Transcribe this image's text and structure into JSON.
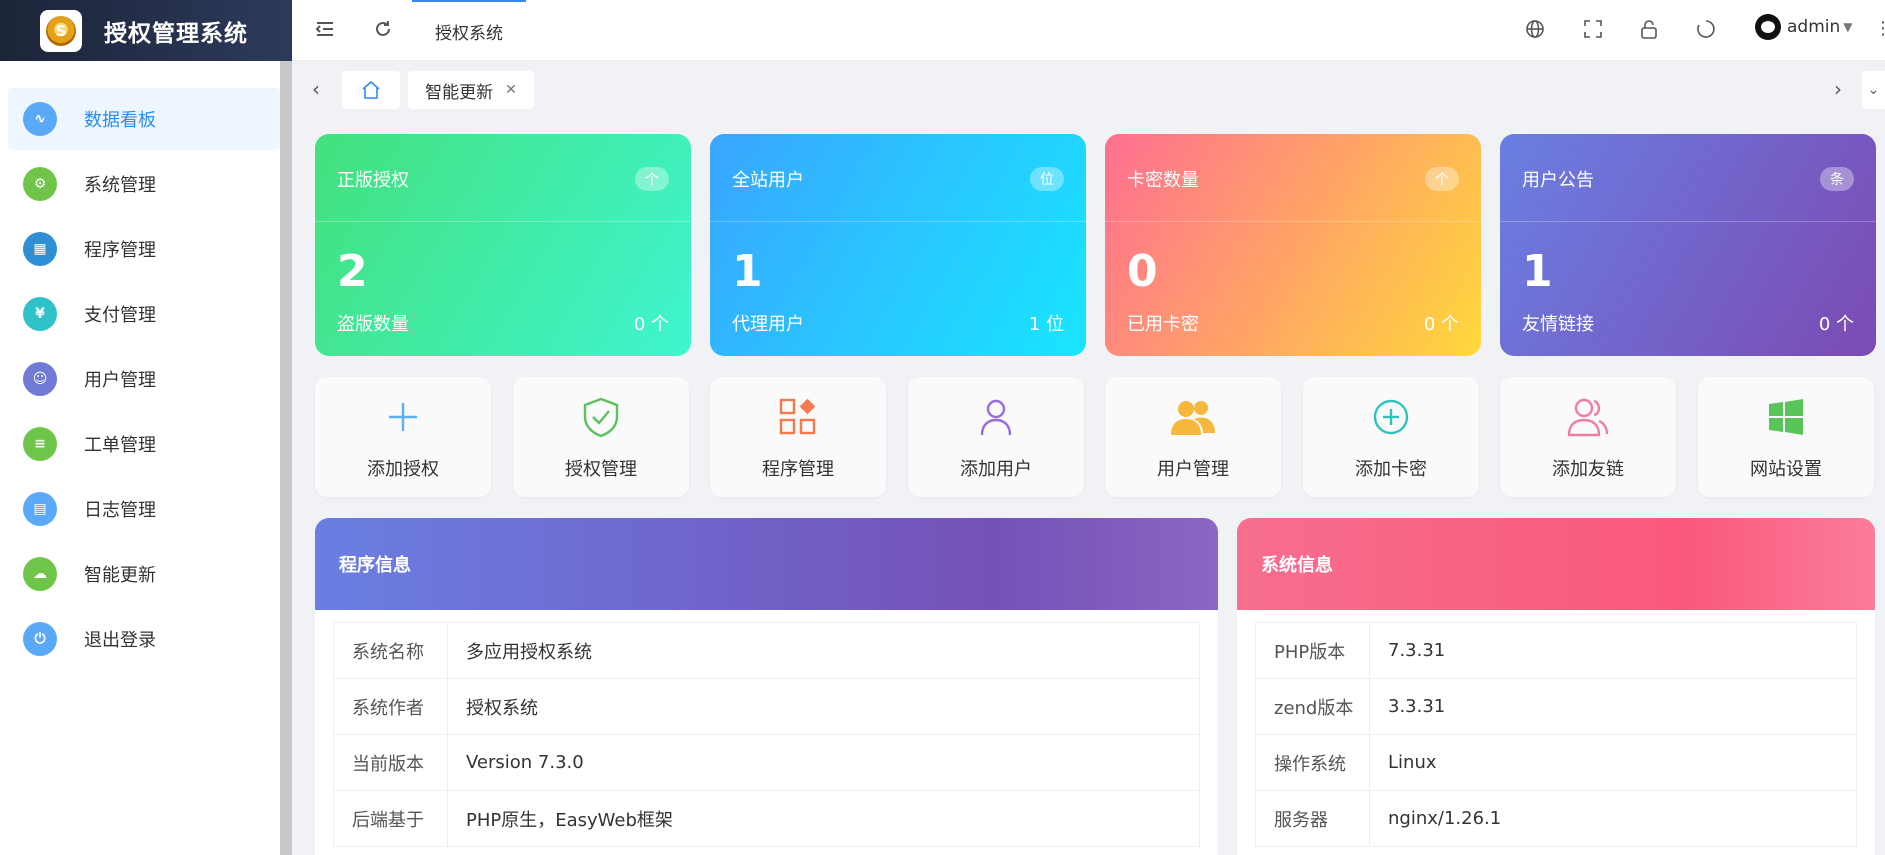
{
  "app": {
    "title": "授权管理系统",
    "logo_glyph": "S"
  },
  "topbar": {
    "current_tab": "授权系统",
    "user": "admin",
    "icons": [
      "menu-fold-icon",
      "refresh-icon",
      "globe-icon",
      "fullscreen-icon",
      "lock-icon",
      "reload-icon",
      "more-icon"
    ]
  },
  "sidebar": {
    "items": [
      {
        "label": "数据看板",
        "icon": "pulse-icon",
        "color": "#5aa9f7",
        "glyph": "∿",
        "active": true
      },
      {
        "label": "系统管理",
        "icon": "gear-icon",
        "color": "#6fc54a",
        "glyph": "⚙",
        "active": false
      },
      {
        "label": "程序管理",
        "icon": "apps-icon",
        "color": "#2f8fd4",
        "glyph": "▦",
        "active": false
      },
      {
        "label": "支付管理",
        "icon": "yen-icon",
        "color": "#2fc2c9",
        "glyph": "¥",
        "active": false
      },
      {
        "label": "用户管理",
        "icon": "users-icon",
        "color": "#6f7bd6",
        "glyph": "☺",
        "active": false
      },
      {
        "label": "工单管理",
        "icon": "clipboard-icon",
        "color": "#6fc54a",
        "glyph": "≡",
        "active": false
      },
      {
        "label": "日志管理",
        "icon": "document-icon",
        "color": "#5aa9f7",
        "glyph": "▤",
        "active": false
      },
      {
        "label": "智能更新",
        "icon": "cloud-upload-icon",
        "color": "#6fc54a",
        "glyph": "☁",
        "active": false
      },
      {
        "label": "退出登录",
        "icon": "power-icon",
        "color": "#5aa9f7",
        "glyph": "⏻",
        "active": false
      }
    ]
  },
  "tabbar": {
    "page_tab": "智能更新",
    "close_glyph": "✕"
  },
  "stats": [
    {
      "title": "正版授权",
      "badge": "个",
      "value": "2",
      "foot_label": "盗版数量",
      "foot_value": "0 个",
      "gradient": [
        "#43e17c",
        "#3ff5d0"
      ]
    },
    {
      "title": "全站用户",
      "badge": "位",
      "value": "1",
      "foot_label": "代理用户",
      "foot_value": "1 位",
      "gradient": [
        "#3aa5ff",
        "#18e6ff"
      ]
    },
    {
      "title": "卡密数量",
      "badge": "个",
      "value": "0",
      "foot_label": "已用卡密",
      "foot_value": "0 个",
      "gradient": [
        "#ff6f91",
        "#ffd83b"
      ]
    },
    {
      "title": "用户公告",
      "badge": "条",
      "value": "1",
      "foot_label": "友情链接",
      "foot_value": "0 个",
      "gradient": [
        "#6a7fe2",
        "#7b4ab3"
      ]
    }
  ],
  "quick_actions": [
    {
      "label": "添加授权",
      "icon": "plus-icon",
      "color": "#5ab0f0"
    },
    {
      "label": "授权管理",
      "icon": "shield-check-icon",
      "color": "#5cc05c"
    },
    {
      "label": "程序管理",
      "icon": "apps-icon",
      "color": "#f47a4c"
    },
    {
      "label": "添加用户",
      "icon": "user-icon",
      "color": "#9a6ae0"
    },
    {
      "label": "用户管理",
      "icon": "users-icon",
      "color": "#f5b83a"
    },
    {
      "label": "添加卡密",
      "icon": "plus-circle-icon",
      "color": "#2fc2bd"
    },
    {
      "label": "添加友链",
      "icon": "user-group-icon",
      "color": "#f07ca6"
    },
    {
      "label": "网站设置",
      "icon": "windows-icon",
      "color": "#58c45a"
    }
  ],
  "program_info": {
    "title": "程序信息",
    "rows": [
      {
        "key": "系统名称",
        "value": "多应用授权系统"
      },
      {
        "key": "系统作者",
        "value": "授权系统"
      },
      {
        "key": "当前版本",
        "value": "Version 7.3.0"
      },
      {
        "key": "后端基于",
        "value": "PHP原生，EasyWeb框架"
      }
    ]
  },
  "system_info": {
    "title": "系统信息",
    "rows": [
      {
        "key": "PHP版本",
        "value": "7.3.31"
      },
      {
        "key": "zend版本",
        "value": "3.3.31"
      },
      {
        "key": "操作系统",
        "value": "Linux"
      },
      {
        "key": "服务器",
        "value": "nginx/1.26.1"
      }
    ]
  }
}
